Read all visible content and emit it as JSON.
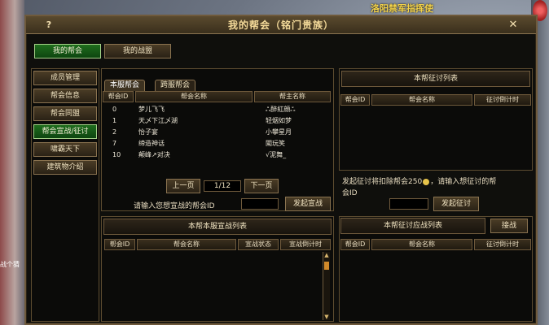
{
  "background": {
    "banner": "洛阳禁军指挥使",
    "left_text": "战个猜"
  },
  "window": {
    "title": "我的帮会（铭门贵族）",
    "help_label": "?",
    "close_label": "✕"
  },
  "top_tabs": [
    {
      "label": "我的帮会",
      "active": true
    },
    {
      "label": "我的战盟",
      "active": false
    }
  ],
  "sidebar": {
    "items": [
      {
        "label": "成员管理",
        "active": false
      },
      {
        "label": "帮会信息",
        "active": false
      },
      {
        "label": "帮会同盟",
        "active": false
      },
      {
        "label": "帮会宣战/征讨",
        "active": true
      },
      {
        "label": "啸霸天下",
        "active": false
      },
      {
        "label": "建筑物介绍",
        "active": false
      }
    ]
  },
  "server_tabs": [
    {
      "label": "本服帮会",
      "active": true
    },
    {
      "label": "跨服帮会",
      "active": false
    }
  ],
  "guild_table": {
    "headers": [
      "帮会ID",
      "帮会名称",
      "帮主名称"
    ],
    "rows": [
      {
        "id": "0",
        "name": "梦儿飞飞",
        "leader": "ஃ醉紅顔ஃ"
      },
      {
        "id": "1",
        "name": "天乄下江乄湖",
        "leader": "轻烟如梦"
      },
      {
        "id": "2",
        "name": "怡子宴",
        "leader": "小攀星月"
      },
      {
        "id": "7",
        "name": "缔造神话",
        "leader": "闖玩笑"
      },
      {
        "id": "10",
        "name": "颠峰↗对决",
        "leader": "√泥舞_"
      }
    ]
  },
  "pager": {
    "prev_label": "上一页",
    "page_text": "1/12",
    "next_label": "下一页"
  },
  "declare": {
    "prompt": "请输入您想宣战的帮会ID",
    "input_value": "",
    "button_label": "发起宣战"
  },
  "war_list": {
    "title": "本帮本服宣战列表",
    "headers": [
      "帮会ID",
      "帮会名称",
      "宣战状态",
      "宣战倒计时"
    ]
  },
  "expedition_list": {
    "title": "本帮征讨列表",
    "headers": [
      "帮会ID",
      "帮会名称",
      "征讨倒计时"
    ]
  },
  "expedition_form": {
    "notice_line1": "发起征讨将扣除帮会250",
    "notice_line1b": "，请输入想征讨的帮",
    "notice_line2": "会ID",
    "input_value": "",
    "button_label": "发起征讨"
  },
  "response_list": {
    "title": "本帮征讨应战列表",
    "accept_label": "接战",
    "headers": [
      "帮会ID",
      "帮会名称",
      "征讨倒计时"
    ]
  },
  "colors": {
    "gold_border": "#8a7350",
    "active_green": "#1f6d1d",
    "title_gold": "#f3d999"
  }
}
